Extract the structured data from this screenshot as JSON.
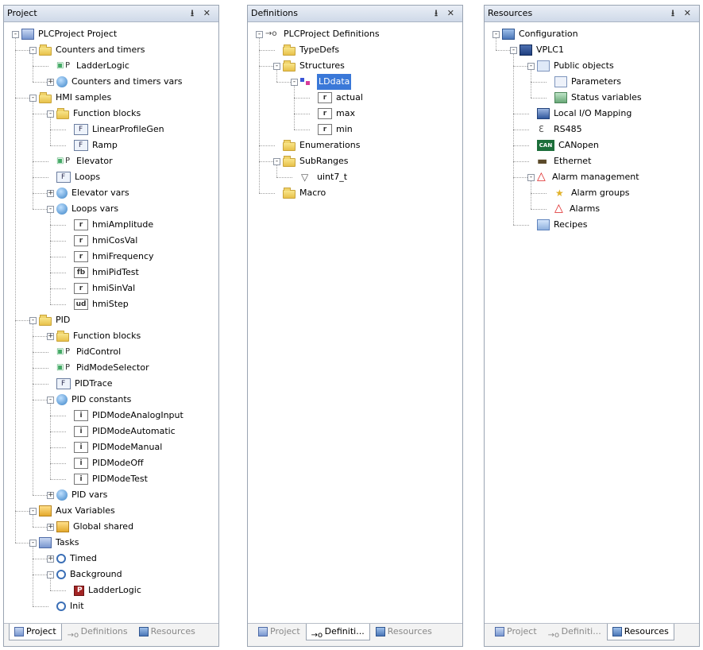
{
  "project_panel": {
    "title": "Project",
    "buttons": "⭳ ✕",
    "tree": [
      {
        "label": "PLCProject Project",
        "icon": "project-icon"
      },
      {
        "label": "Counters and timers",
        "icon": "folder-icon"
      },
      {
        "label": "LadderLogic",
        "icon": "ladder-program-icon"
      },
      {
        "label": "Counters and timers vars",
        "icon": "variables-globe-icon"
      },
      {
        "label": "HMI samples",
        "icon": "folder-icon"
      },
      {
        "label": "Function blocks",
        "icon": "folder-icon"
      },
      {
        "label": "LinearProfileGen",
        "icon": "function-block-icon"
      },
      {
        "label": "Ramp",
        "icon": "function-block-icon"
      },
      {
        "label": "Elevator",
        "icon": "ladder-program-icon"
      },
      {
        "label": "Loops",
        "icon": "function-block-icon"
      },
      {
        "label": "Elevator vars",
        "icon": "variables-globe-icon"
      },
      {
        "label": "Loops vars",
        "icon": "variables-globe-icon"
      },
      {
        "label": "hmiAmplitude",
        "icon": "variable-icon",
        "badge": "r"
      },
      {
        "label": "hmiCosVal",
        "icon": "variable-icon",
        "badge": "r"
      },
      {
        "label": "hmiFrequency",
        "icon": "variable-icon",
        "badge": "r"
      },
      {
        "label": "hmiPidTest",
        "icon": "variable-icon",
        "badge": "fb"
      },
      {
        "label": "hmiSinVal",
        "icon": "variable-icon",
        "badge": "r"
      },
      {
        "label": "hmiStep",
        "icon": "variable-icon",
        "badge": "ud"
      },
      {
        "label": "PID",
        "icon": "folder-icon"
      },
      {
        "label": "Function blocks",
        "icon": "folder-icon"
      },
      {
        "label": "PidControl",
        "icon": "ladder-program-icon"
      },
      {
        "label": "PidModeSelector",
        "icon": "sfc-program-icon"
      },
      {
        "label": "PIDTrace",
        "icon": "function-block-icon"
      },
      {
        "label": "PID constants",
        "icon": "variables-globe-icon"
      },
      {
        "label": "PIDModeAnalogInput",
        "icon": "variable-icon",
        "badge": "i"
      },
      {
        "label": "PIDModeAutomatic",
        "icon": "variable-icon",
        "badge": "i"
      },
      {
        "label": "PIDModeManual",
        "icon": "variable-icon",
        "badge": "i"
      },
      {
        "label": "PIDModeOff",
        "icon": "variable-icon",
        "badge": "i"
      },
      {
        "label": "PIDModeTest",
        "icon": "variable-icon",
        "badge": "i"
      },
      {
        "label": "PID vars",
        "icon": "variables-globe-icon"
      },
      {
        "label": "Aux Variables",
        "icon": "aux-variables-icon"
      },
      {
        "label": "Global shared",
        "icon": "global-shared-icon"
      },
      {
        "label": "Tasks",
        "icon": "tasks-icon"
      },
      {
        "label": "Timed",
        "icon": "task-icon"
      },
      {
        "label": "Background",
        "icon": "task-icon"
      },
      {
        "label": "LadderLogic",
        "icon": "program-instance-icon"
      },
      {
        "label": "Init",
        "icon": "task-icon"
      }
    ],
    "tabs": [
      "Project",
      "Definitions",
      "Resources"
    ]
  },
  "definitions_panel": {
    "title": "Definitions",
    "buttons": "⭳ ✕",
    "tree": [
      {
        "label": "PLCProject Definitions",
        "icon": "definitions-icon"
      },
      {
        "label": "TypeDefs",
        "icon": "folder-icon"
      },
      {
        "label": "Structures",
        "icon": "folder-icon"
      },
      {
        "label": "LDdata",
        "icon": "structure-icon"
      },
      {
        "label": "actual",
        "icon": "variable-icon",
        "badge": "r"
      },
      {
        "label": "max",
        "icon": "variable-icon",
        "badge": "r"
      },
      {
        "label": "min",
        "icon": "variable-icon",
        "badge": "r"
      },
      {
        "label": "Enumerations",
        "icon": "folder-icon"
      },
      {
        "label": "SubRanges",
        "icon": "folder-icon"
      },
      {
        "label": "uint7_t",
        "icon": "subrange-icon"
      },
      {
        "label": "Macro",
        "icon": "folder-icon"
      }
    ],
    "tabs": [
      "Project",
      "Definiti...",
      "Resources"
    ]
  },
  "resources_panel": {
    "title": "Resources",
    "buttons": "⭳ ✕",
    "tree": [
      {
        "label": "Configuration",
        "icon": "configuration-icon"
      },
      {
        "label": "VPLC1",
        "icon": "plc-icon"
      },
      {
        "label": "Public objects",
        "icon": "public-objects-icon"
      },
      {
        "label": "Parameters",
        "icon": "parameters-icon"
      },
      {
        "label": "Status variables",
        "icon": "status-variables-icon"
      },
      {
        "label": "Local I/O Mapping",
        "icon": "io-mapping-icon"
      },
      {
        "label": "RS485",
        "icon": "rs485-icon"
      },
      {
        "label": "CANopen",
        "icon": "canopen-icon",
        "badge": "CAN"
      },
      {
        "label": "Ethernet",
        "icon": "ethernet-icon"
      },
      {
        "label": "Alarm management",
        "icon": "alarm-management-icon"
      },
      {
        "label": "Alarm groups",
        "icon": "alarm-groups-icon"
      },
      {
        "label": "Alarms",
        "icon": "alarm-icon"
      },
      {
        "label": "Recipes",
        "icon": "recipes-icon"
      }
    ],
    "tabs": [
      "Project",
      "Definiti...",
      "Resources"
    ]
  },
  "colors": {
    "selection": "#3a78d8",
    "titlebar": "#d8e1ee"
  }
}
